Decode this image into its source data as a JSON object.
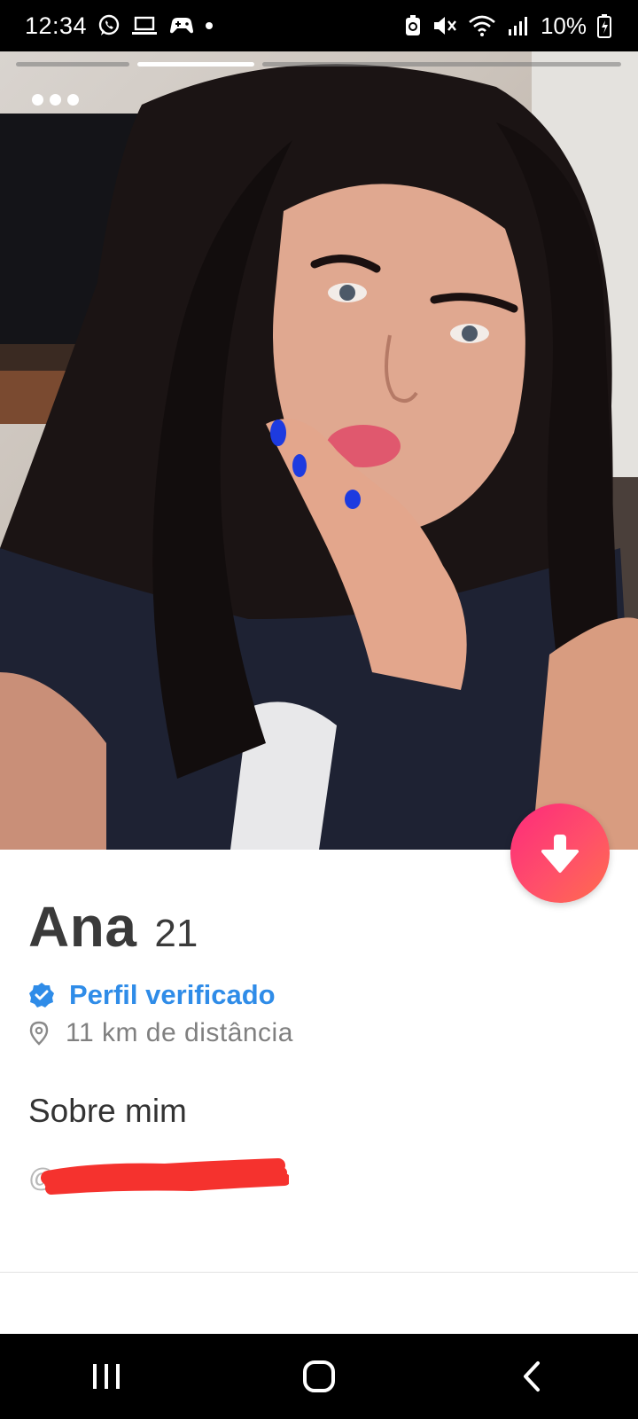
{
  "status_bar": {
    "time": "12:34",
    "battery": "10%",
    "icons": [
      "whatsapp-icon",
      "laptop-icon",
      "game-controller-icon",
      "notification-dot",
      "battery-saver-icon",
      "mute-icon",
      "wifi-icon",
      "signal-icon",
      "battery-charging-icon"
    ]
  },
  "photo": {
    "pages": 3,
    "current_page": 2,
    "menu_icon": "more-dots-icon"
  },
  "profile": {
    "name": "Ana",
    "age": "21",
    "verified_label": "Perfil verificado",
    "distance": "11 km de distância",
    "about_title": "Sobre mim",
    "handle_prefix": "@"
  },
  "colors": {
    "accent_gradient_start": "#fd2a7b",
    "accent_gradient_end": "#ff6d4d",
    "verified_blue": "#2f8ce8",
    "redaction_red": "#f5322e"
  },
  "nav_bar": {
    "buttons": [
      "recent-apps-icon",
      "home-icon",
      "back-icon"
    ]
  }
}
